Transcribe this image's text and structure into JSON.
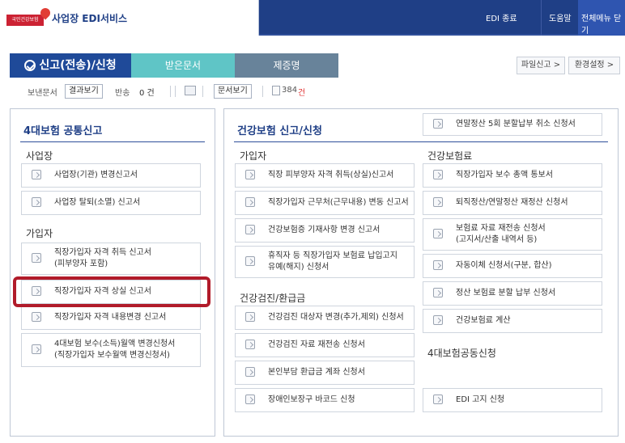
{
  "header": {
    "logo_text": "국민건강보험",
    "title": "사업장 EDI서비스",
    "links": [
      {
        "label": "EDI 종료"
      },
      {
        "label": "도움말"
      },
      {
        "label": "전체메뉴 닫기"
      }
    ]
  },
  "tabs": [
    {
      "label": "신고(전송)/신청",
      "active": true
    },
    {
      "label": "받은문서",
      "active": false
    },
    {
      "label": "제증명",
      "active": false
    }
  ],
  "right_buttons": [
    {
      "label": "파일신고 >"
    },
    {
      "label": "환경설정 >"
    }
  ],
  "toolbar": {
    "sent_label": "보낸문서",
    "result_button": "결과보기",
    "return_label": "반송",
    "return_count": "0 건",
    "doc_button": "문서보기",
    "doc_count_number": "384",
    "doc_count_unit": "건"
  },
  "left_panel": {
    "title": "4대보험 공통신고",
    "sections": [
      {
        "title": "사업장",
        "items": [
          "사업장(기관) 변경신고서",
          "사업장 탈퇴(소멸) 신고서"
        ]
      },
      {
        "title": "가입자",
        "items": [
          "직장가입자 자격 취득 신고서\n(피부양자 포함)",
          "직장가입자 자격 상실 신고서",
          "직장가입자 자격 내용변경 신고서",
          "4대보험 보수(소득)월액 변경신청서\n(직장가입자 보수월액 변경신청서)"
        ]
      }
    ]
  },
  "right_panel": {
    "title": "건강보험 신고/신청",
    "top_item": "연말정산 5회 분할납부 취소 신청서",
    "col1": {
      "section1": {
        "title": "가입자",
        "items": [
          "직장 피부양자 자격 취득(상실)신고서",
          "직장가입자 근무처(근무내용) 변동 신고서",
          "건강보험증 기재사항 변경 신고서",
          "휴직자 등 직장가입자 보험료 납입고지\n유예(해지) 신청서"
        ]
      },
      "section2": {
        "title": "건강검진/환급금",
        "items": [
          "건강검진 대상자 변경(추가,제외) 신청서",
          "건강검진 자료 재전송 신청서",
          "본인부담 환급금 계좌 신청서",
          "장애인보장구 바코드 신청"
        ]
      }
    },
    "col2": {
      "section1": {
        "title": "건강보험료",
        "items": [
          "직장가입자 보수 총액 통보서",
          "퇴직정산/연말정산 재정산 신청서",
          "보험료 자료 재전송 신청서\n(고지서/산출 내역서 등)",
          "자동이체 신청서(구분, 합산)",
          "정산 보험료 분할 납부 신청서",
          "건강보험료 계산"
        ]
      },
      "section2": {
        "title": "4대보험공동신청",
        "items": [
          "EDI 고지 신청"
        ]
      }
    }
  },
  "colors": {
    "header_bg": "#1f3f86",
    "tab_active": "#1f4a99",
    "tab_teal": "#5fc5c6",
    "tab_slate": "#68839a",
    "highlight": "#b11b2a"
  }
}
